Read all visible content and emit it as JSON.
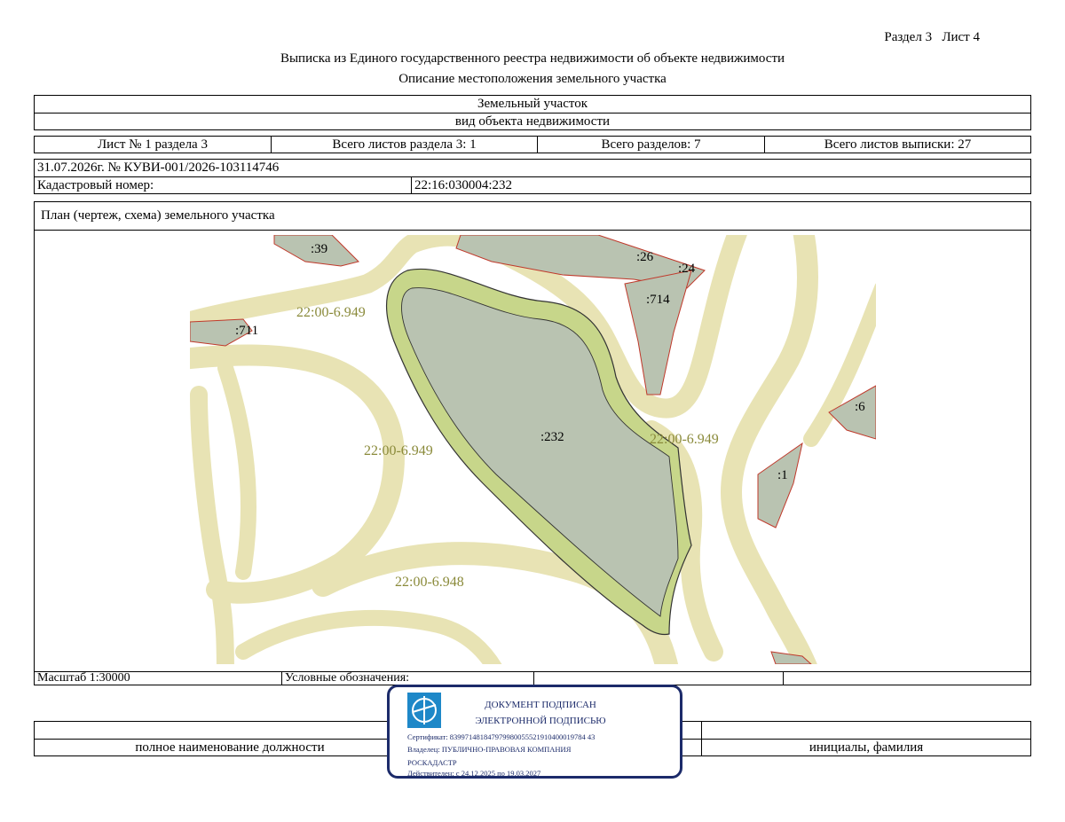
{
  "header": {
    "section": "Раздел 3",
    "sheet": "Лист 4",
    "title": "Выписка из Единого государственного реестра недвижимости об объекте недвижимости",
    "subtitle": "Описание местоположения земельного участка"
  },
  "object": {
    "type": "Земельный участок",
    "type_caption": "вид объекта недвижимости"
  },
  "sheets": {
    "sheet_no": "Лист № 1 раздела 3",
    "section_sheets": "Всего листов раздела 3: 1",
    "sections_total": "Всего разделов: 7",
    "extract_sheets": "Всего листов выписки: 27"
  },
  "record": {
    "date_number": "31.07.2026г. № КУВИ-001/2026-103114746",
    "cadastral_label": "Кадастровый номер:",
    "cadastral_value": "22:16:030004:232"
  },
  "plan": {
    "heading": "План (чертеж, схема) земельного участка",
    "labels": {
      "l39": ":39",
      "l26": ":26",
      "l24": ":24",
      "l714": ":714",
      "l711": ":711",
      "l6": ":6",
      "l1": ":1",
      "l232": ":232",
      "zone1": "22:00-6.949",
      "zone2": "22:00-6.949",
      "zone3": "22:00-6.949",
      "zone4": "22:00-6.948"
    },
    "colors": {
      "zone_fill": "#e8e3b4",
      "parcel_fill": "#b9c3b1",
      "buffer_fill": "#c7d68a",
      "border_red": "#c0392b",
      "zone_label": "#8a8a3a"
    }
  },
  "footer": {
    "scale": "Масштаб 1:30000",
    "legend": "Условные обозначения:",
    "position_caption": "полное наименование должности",
    "name_caption": "инициалы, фамилия"
  },
  "stamp": {
    "line1": "ДОКУМЕНТ ПОДПИСАН",
    "line2": "ЭЛЕКТРОННОЙ ПОДПИСЬЮ",
    "certificate": "Сертификат: 839971481847979980055521910400019784 43",
    "owner": "Владелец: ПУБЛИЧНО-ПРАВОВАЯ КОМПАНИЯ",
    "owner2": "РОСКАДАСТР",
    "valid": "Действителен: с 24.12.2025 по 19.03.2027",
    "logo": "roskadastr-logo"
  }
}
